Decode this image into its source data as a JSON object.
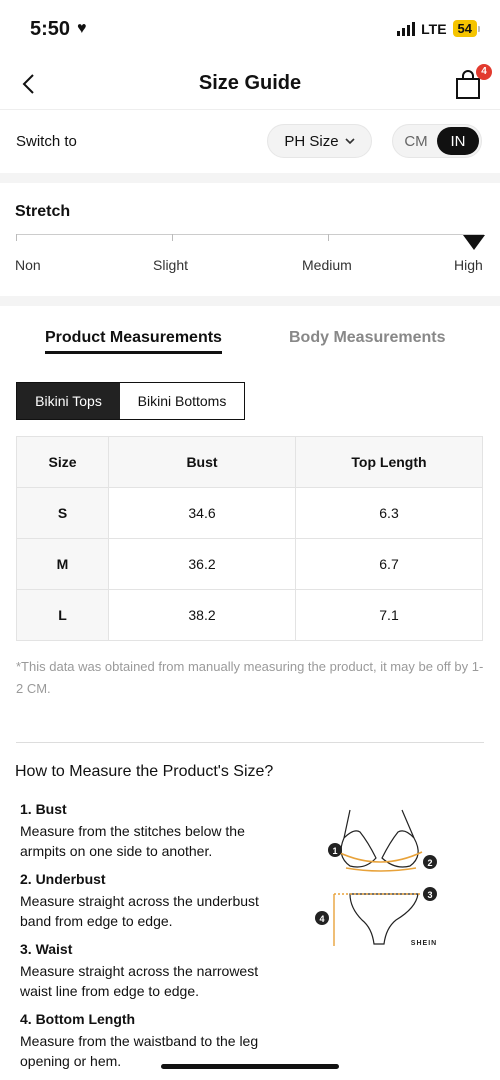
{
  "status_bar": {
    "time": "5:50",
    "network": "LTE",
    "battery": "54"
  },
  "header": {
    "title": "Size Guide",
    "bag_count": "4"
  },
  "switch_row": {
    "label": "Switch to",
    "size_system": "PH Size",
    "units": [
      "CM",
      "IN"
    ],
    "selected_unit": "IN"
  },
  "stretch": {
    "title": "Stretch",
    "levels": [
      "Non",
      "Slight",
      "Medium",
      "High"
    ],
    "selected_level": "High"
  },
  "tabs": [
    {
      "label": "Product Measurements",
      "active": true
    },
    {
      "label": "Body Measurements",
      "active": false
    }
  ],
  "segments": [
    {
      "label": "Bikini Tops",
      "active": true
    },
    {
      "label": "Bikini Bottoms",
      "active": false
    }
  ],
  "table": {
    "headers": [
      "Size",
      "Bust",
      "Top Length"
    ],
    "rows": [
      [
        "S",
        "34.6",
        "6.3"
      ],
      [
        "M",
        "36.2",
        "6.7"
      ],
      [
        "L",
        "38.2",
        "7.1"
      ]
    ]
  },
  "note": "*This data was obtained from manually measuring the product, it may be off by 1-2 CM.",
  "how_to": {
    "title": "How to Measure the Product's Size?",
    "items": [
      {
        "title": "1. Bust",
        "desc": "Measure from the stitches below the armpits on one side to another."
      },
      {
        "title": "2. Underbust",
        "desc": "Measure straight across the underbust band from edge to edge."
      },
      {
        "title": "3. Waist",
        "desc": "Measure straight across the narrowest waist line from edge to edge."
      },
      {
        "title": "4. Bottom Length",
        "desc": "Measure from the waistband to the leg opening or hem."
      }
    ],
    "diagram": {
      "markers": [
        "1",
        "2",
        "3",
        "4"
      ],
      "brand": "SHEIN"
    }
  },
  "colors": {
    "accent": "#111111",
    "badge": "#e23a2e",
    "battery": "#f5c400",
    "measure_line": "#e8a23a"
  }
}
